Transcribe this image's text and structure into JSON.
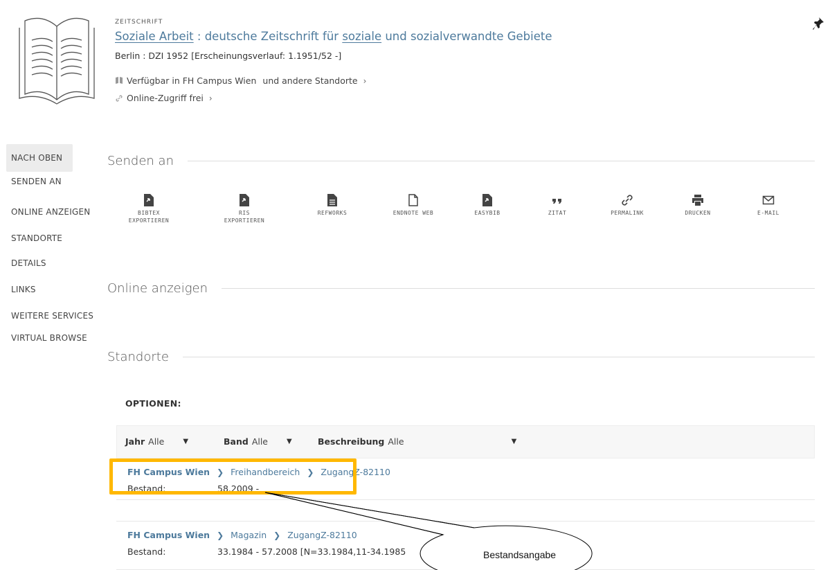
{
  "record": {
    "type": "ZEITSCHRIFT",
    "title_part1": "Soziale Arbeit",
    "title_part2": " : deutsche Zeitschrift für ",
    "title_part3": "soziale",
    "title_part4": " und sozialverwandte Gebiete",
    "publication": "Berlin : DZI 1952 [Erscheinungsverlauf: 1.1951/52 -]",
    "availability_location": "Verfügbar in FH Campus Wien",
    "availability_more": "und andere Standorte",
    "online_access": "Online-Zugriff frei",
    "icons": {
      "book": "open-book-icon",
      "pin": "pin-icon",
      "availability": "book-icon",
      "online": "link-icon"
    }
  },
  "nav": {
    "items": [
      {
        "label": "NACH OBEN",
        "active": true
      },
      {
        "label": "SENDEN AN"
      },
      {
        "label": "ONLINE ANZEIGEN"
      },
      {
        "label": "STANDORTE"
      },
      {
        "label": "DETAILS"
      },
      {
        "label": "LINKS"
      },
      {
        "label": "WEITERE SERVICES"
      },
      {
        "label": "VIRTUAL BROWSE"
      }
    ]
  },
  "send": {
    "heading": "Senden an",
    "buttons": [
      {
        "label": "BIBTEX\nEXPORTIEREN",
        "icon": "file-export-icon"
      },
      {
        "label": "RIS\nEXPORTIEREN",
        "icon": "file-export-icon"
      },
      {
        "label": "REFWORKS",
        "icon": "file-text-icon"
      },
      {
        "label": "ENDNOTE WEB",
        "icon": "file-outline-icon"
      },
      {
        "label": "EASYBIB",
        "icon": "file-export-icon"
      },
      {
        "label": "ZITAT",
        "icon": "quote-icon"
      },
      {
        "label": "PERMALINK",
        "icon": "link-icon"
      },
      {
        "label": "DRUCKEN",
        "icon": "printer-icon"
      },
      {
        "label": "E-MAIL",
        "icon": "mail-icon"
      }
    ]
  },
  "online": {
    "heading": "Online anzeigen"
  },
  "locations": {
    "heading": "Standorte",
    "options_label": "OPTIONEN:",
    "filters": [
      {
        "key": "Jahr",
        "value": "Alle"
      },
      {
        "key": "Band",
        "value": "Alle"
      },
      {
        "key": "Beschreibung",
        "value": "Alle"
      }
    ],
    "rows": [
      {
        "library": "FH Campus Wien",
        "sublocation": "Freihandbereich",
        "callnumber": "ZugangZ-82110",
        "holding_label": "Bestand:",
        "holding": "58.2009 -"
      },
      {
        "library": "FH Campus Wien",
        "sublocation": "Magazin",
        "callnumber": "ZugangZ-82110",
        "holding_label": "Bestand:",
        "holding": "33.1984 - 57.2008 [N=33.1984,11-34.1985"
      }
    ]
  },
  "annotation": {
    "callout_text": "Bestandsangabe",
    "highlight_color": "#ffb800"
  }
}
